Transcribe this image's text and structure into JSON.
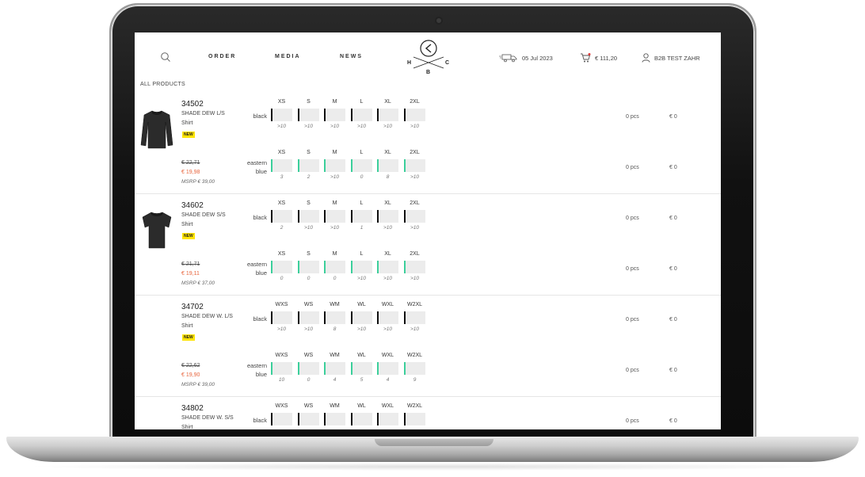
{
  "nav": {
    "order": "ORDER",
    "media": "MEDIA",
    "news": "NEWS",
    "date": "05 Jul 2023",
    "cart_total": "€ 111,20",
    "user": "B2B TEST ZAHR"
  },
  "logo": {
    "h": "H",
    "b": "B",
    "c": "C"
  },
  "breadcrumb": "ALL PRODUCTS",
  "products": [
    {
      "number": "34502",
      "name": "SHADE DEW L/S Shirt",
      "badge": "NEW",
      "price_old": "€ 22,71",
      "price_new": "€ 19,98",
      "msrp": "MSRP € 39,00",
      "variants": [
        {
          "color": "black",
          "sizes": [
            "XS",
            "S",
            "M",
            "L",
            "XL",
            "2XL"
          ],
          "stock": [
            ">10",
            ">10",
            ">10",
            ">10",
            ">10",
            ">10"
          ],
          "qty": "0 pcs",
          "total": "€ 0"
        },
        {
          "color": "eastern blue",
          "sizes": [
            "XS",
            "S",
            "M",
            "L",
            "XL",
            "2XL"
          ],
          "stock": [
            "3",
            "2",
            ">10",
            "0",
            "8",
            ">10"
          ],
          "qty": "0 pcs",
          "total": "€ 0"
        }
      ]
    },
    {
      "number": "34602",
      "name": "SHADE DEW S/S Shirt",
      "badge": "NEW",
      "price_old": "€ 21,71",
      "price_new": "€ 19,11",
      "msrp": "MSRP € 37,00",
      "variants": [
        {
          "color": "black",
          "sizes": [
            "XS",
            "S",
            "M",
            "L",
            "XL",
            "2XL"
          ],
          "stock": [
            "2",
            ">10",
            ">10",
            "1",
            ">10",
            ">10"
          ],
          "qty": "0 pcs",
          "total": "€ 0"
        },
        {
          "color": "eastern blue",
          "sizes": [
            "XS",
            "S",
            "M",
            "L",
            "XL",
            "2XL"
          ],
          "stock": [
            "0",
            "0",
            "0",
            ">10",
            ">10",
            ">10"
          ],
          "qty": "0 pcs",
          "total": "€ 0"
        }
      ]
    },
    {
      "number": "34702",
      "name": "SHADE DEW W. L/S Shirt",
      "badge": "NEW",
      "price_old": "€ 22,62",
      "price_new": "€ 19,90",
      "msrp": "MSRP € 39,00",
      "variants": [
        {
          "color": "black",
          "sizes": [
            "WXS",
            "WS",
            "WM",
            "WL",
            "WXL",
            "W2XL"
          ],
          "stock": [
            ">10",
            ">10",
            "8",
            ">10",
            ">10",
            ">10"
          ],
          "qty": "0 pcs",
          "total": "€ 0"
        },
        {
          "color": "eastern blue",
          "sizes": [
            "WXS",
            "WS",
            "WM",
            "WL",
            "WXL",
            "W2XL"
          ],
          "stock": [
            "10",
            "0",
            "4",
            "5",
            "4",
            "9"
          ],
          "qty": "0 pcs",
          "total": "€ 0"
        }
      ]
    },
    {
      "number": "34802",
      "name": "SHADE DEW W. S/S Shirt",
      "badge": "",
      "price_old": "",
      "price_new": "",
      "msrp": "",
      "variants": [
        {
          "color": "black",
          "sizes": [
            "WXS",
            "WS",
            "WM",
            "WL",
            "WXL",
            "W2XL"
          ],
          "stock": [
            "",
            "",
            "",
            "",
            "",
            ""
          ],
          "qty": "0 pcs",
          "total": "€ 0"
        }
      ]
    }
  ],
  "colors": {
    "black_bar": "#111111",
    "blue_bar": "#3ccf9b",
    "badge": "#ffe400",
    "sale": "#e8643c"
  }
}
